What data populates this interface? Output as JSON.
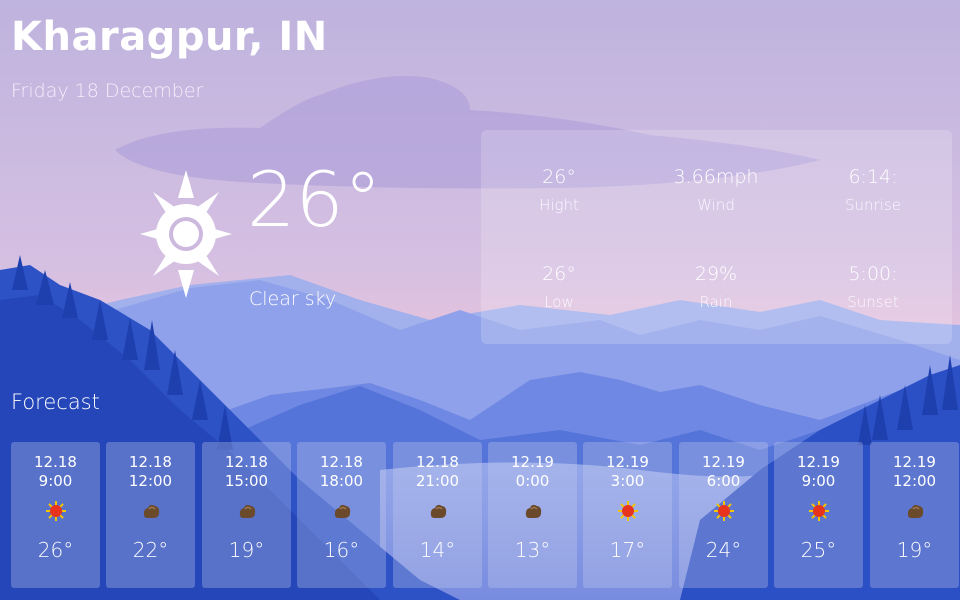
{
  "location": {
    "city": "Kharagpur, IN",
    "date": "Friday 18 December"
  },
  "current": {
    "temperature": "26°",
    "condition": "Clear sky",
    "icon": "sun-icon"
  },
  "stats": {
    "high": {
      "value": "26°",
      "label": "Hight"
    },
    "wind": {
      "value": "3.66mph",
      "label": "Wind"
    },
    "sunrise": {
      "value": "6:14:",
      "label": "Sunrise"
    },
    "low": {
      "value": "26°",
      "label": "Low"
    },
    "rain": {
      "value": "29%",
      "label": "Rain"
    },
    "sunset": {
      "value": "5:00:",
      "label": "Sunset"
    }
  },
  "forecast": {
    "title": "Forecast",
    "items": [
      {
        "date": "12.18",
        "time": "9:00",
        "icon": "sun-icon",
        "temp": "26°"
      },
      {
        "date": "12.18",
        "time": "12:00",
        "icon": "cloud-icon",
        "temp": "22°"
      },
      {
        "date": "12.18",
        "time": "15:00",
        "icon": "cloud-icon",
        "temp": "19°"
      },
      {
        "date": "12.18",
        "time": "18:00",
        "icon": "cloud-icon",
        "temp": "16°"
      },
      {
        "date": "12.18",
        "time": "21:00",
        "icon": "cloud-icon",
        "temp": "14°"
      },
      {
        "date": "12.19",
        "time": "0:00",
        "icon": "cloud-icon",
        "temp": "13°"
      },
      {
        "date": "12.19",
        "time": "3:00",
        "icon": "sun-icon",
        "temp": "17°"
      },
      {
        "date": "12.19",
        "time": "6:00",
        "icon": "sun-icon",
        "temp": "24°"
      },
      {
        "date": "12.19",
        "time": "9:00",
        "icon": "sun-icon",
        "temp": "25°"
      },
      {
        "date": "12.19",
        "time": "12:00",
        "icon": "cloud-icon",
        "temp": "19°"
      }
    ]
  },
  "colors": {
    "sky_top": "#bdb3e0",
    "sky_bottom": "#f0c2d6",
    "mountain_far": "#93a3e3",
    "mountain_mid": "#5a7ae0",
    "mountain_near": "#2b4fc4",
    "sun_icon": "#e8341c",
    "cloud_icon": "#6b4a2c"
  }
}
